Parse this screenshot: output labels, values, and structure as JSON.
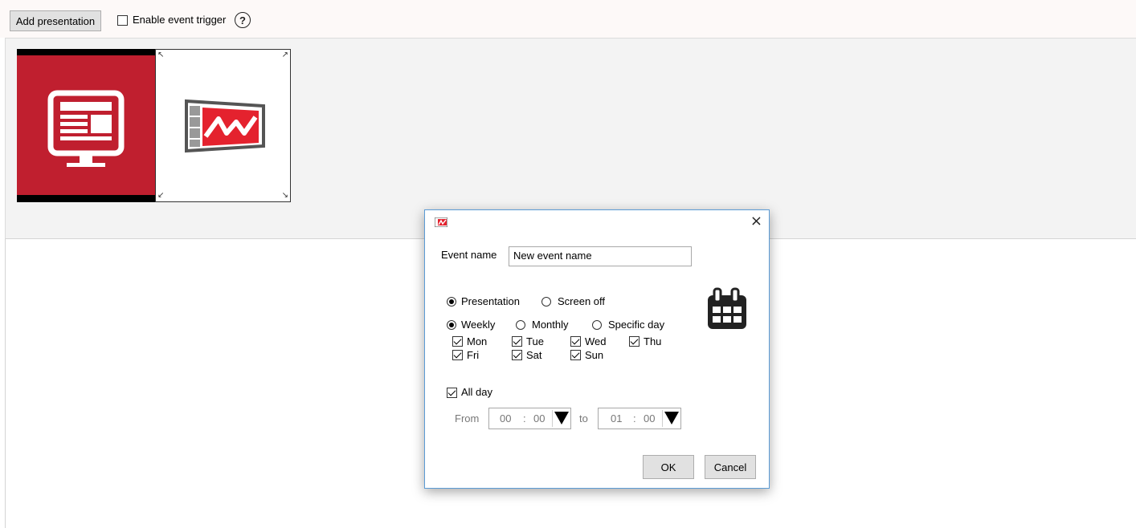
{
  "toolbar": {
    "add_presentation_label": "Add presentation",
    "enable_event_trigger_label": "Enable event trigger",
    "enable_event_trigger_checked": false,
    "help_glyph": "?"
  },
  "thumbnails": [
    {
      "icon": "monitor-icon",
      "background": "#c01f2f"
    },
    {
      "icon": "presentation-logo-icon",
      "background": "#ffffff"
    }
  ],
  "dialog": {
    "close_glyph": "×",
    "event_name_label": "Event name",
    "event_name_value": "New event name",
    "type_options": [
      {
        "label": "Presentation",
        "checked": true
      },
      {
        "label": "Screen off",
        "checked": false
      }
    ],
    "repeat_options": [
      {
        "label": "Weekly",
        "checked": true
      },
      {
        "label": "Monthly",
        "checked": false
      },
      {
        "label": "Specific day",
        "checked": false
      }
    ],
    "days": [
      {
        "label": "Mon",
        "checked": true
      },
      {
        "label": "Tue",
        "checked": true
      },
      {
        "label": "Wed",
        "checked": true
      },
      {
        "label": "Thu",
        "checked": true
      },
      {
        "label": "Fri",
        "checked": true
      },
      {
        "label": "Sat",
        "checked": true
      },
      {
        "label": "Sun",
        "checked": true
      }
    ],
    "all_day_label": "All day",
    "all_day_checked": true,
    "from_label": "From",
    "from_hour": "00",
    "from_minute": "00",
    "to_label": "to",
    "to_hour": "01",
    "to_minute": "00",
    "time_separator": ":",
    "ok_label": "OK",
    "cancel_label": "Cancel",
    "calendar_icon": "calendar-icon",
    "app_icon": "app-logo-icon"
  },
  "colors": {
    "accent_red": "#c01f2f",
    "dialog_border": "#5b9bd5"
  }
}
